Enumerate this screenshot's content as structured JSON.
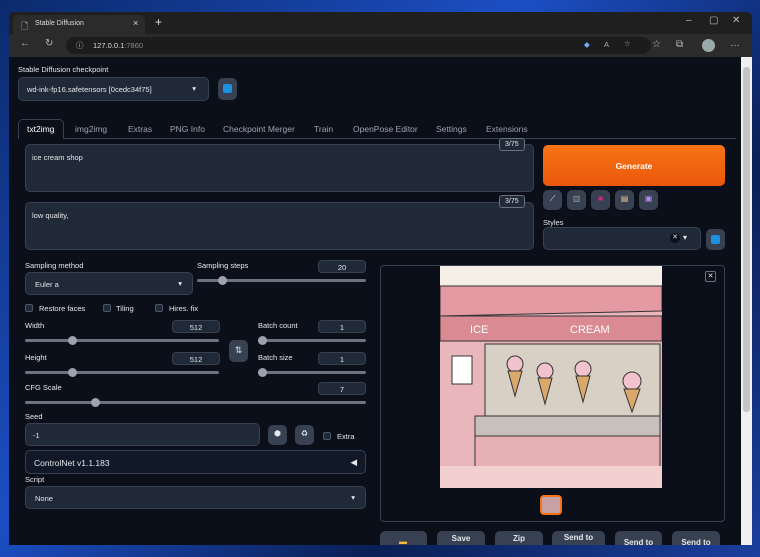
{
  "browser": {
    "tab_title": "Stable Diffusion",
    "url_host": "127.0.0.1",
    "url_port": ":7860"
  },
  "checkpoint": {
    "label": "Stable Diffusion checkpoint",
    "value": "wd-ink-fp16.safetensors [0cedc34f75]"
  },
  "tabs": [
    "txt2img",
    "img2img",
    "Extras",
    "PNG Info",
    "Checkpoint Merger",
    "Train",
    "OpenPose Editor",
    "Settings",
    "Extensions"
  ],
  "prompt": {
    "value": "ice cream shop",
    "counter": "3/75"
  },
  "negative_prompt": {
    "value": "low quality,",
    "counter": "3/75"
  },
  "generate_label": "Generate",
  "styles_label": "Styles",
  "sampling_method": {
    "label": "Sampling method",
    "value": "Euler a"
  },
  "sampling_steps": {
    "label": "Sampling steps",
    "value": "20",
    "fraction": 0.13
  },
  "checkboxes": {
    "restore_faces": "Restore faces",
    "tiling": "Tiling",
    "hires_fix": "Hires. fix"
  },
  "width": {
    "label": "Width",
    "value": "512",
    "fraction": 0.23
  },
  "height": {
    "label": "Height",
    "value": "512",
    "fraction": 0.23
  },
  "batch_count": {
    "label": "Batch count",
    "value": "1",
    "fraction": 0
  },
  "batch_size": {
    "label": "Batch size",
    "value": "1",
    "fraction": 0
  },
  "cfg_scale": {
    "label": "CFG Scale",
    "value": "7",
    "fraction": 0.2
  },
  "seed": {
    "label": "Seed",
    "value": "-1",
    "extra_label": "Extra"
  },
  "controlnet_label": "ControlNet v1.1.183",
  "script": {
    "label": "Script",
    "value": "None"
  },
  "output_buttons": [
    "Save",
    "Zip",
    "Send to",
    "Send to",
    "Send to"
  ],
  "image_sign": {
    "left": "ICE",
    "right": "CREAM"
  },
  "colors": {
    "accent": "#f97316",
    "bg": "#0b0f19",
    "panel": "#1f2937"
  }
}
